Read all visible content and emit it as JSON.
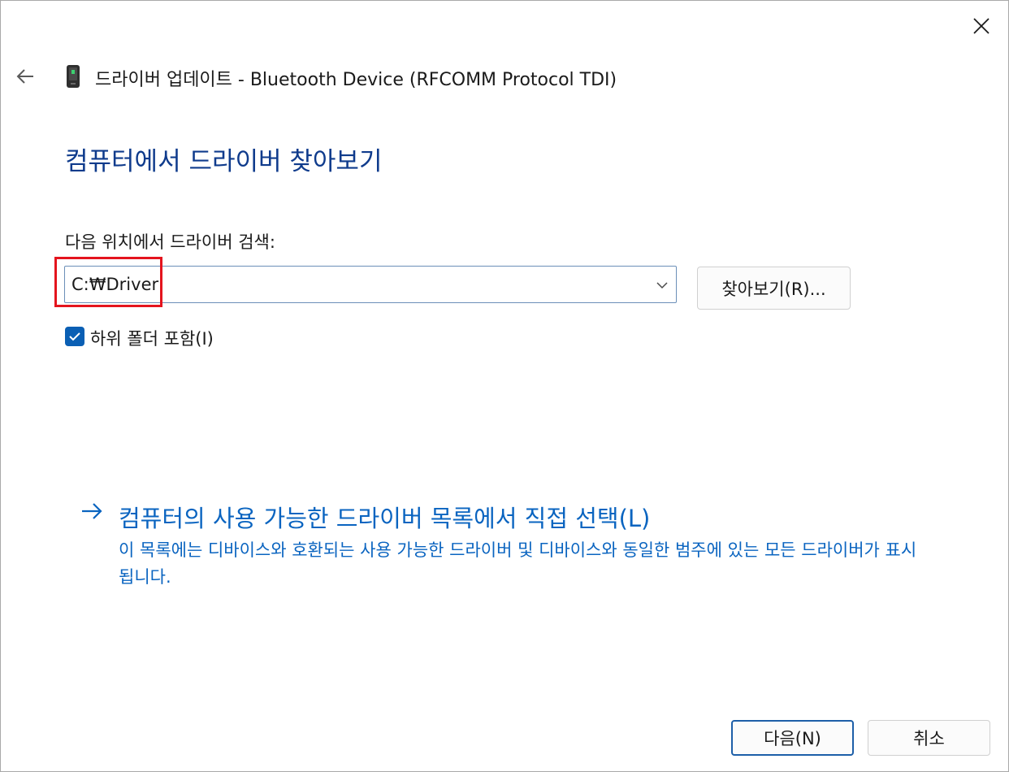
{
  "window": {
    "title": "드라이버 업데이트 - Bluetooth Device (RFCOMM Protocol TDI)"
  },
  "icons": {
    "close": "close-icon",
    "back": "back-arrow-icon",
    "device": "bluetooth-device-icon",
    "combo": "chevron-down-icon",
    "checkbox": "checkmark-icon",
    "link": "arrow-right-icon"
  },
  "main": {
    "heading": "컴퓨터에서 드라이버 찾아보기",
    "search_label": "다음 위치에서 드라이버 검색:",
    "path_value": "C:₩Driver",
    "browse_label": "찾아보기(R)...",
    "include_subfolders": {
      "label": "하위 폴더 포함(I)",
      "checked": true
    }
  },
  "pick_link": {
    "title": "컴퓨터의 사용 가능한 드라이버 목록에서 직접 선택(L)",
    "description": "이 목록에는 디바이스와 호환되는 사용 가능한 드라이버 및 디바이스와 동일한 범주에 있는 모든 드라이버가 표시됩니다."
  },
  "footer": {
    "next_label": "다음(N)",
    "cancel_label": "취소"
  },
  "colors": {
    "heading": "#0f3b8c",
    "link": "#0a64c0",
    "checkbox_accent": "#0a5fb4",
    "highlight": "#e4141e"
  }
}
